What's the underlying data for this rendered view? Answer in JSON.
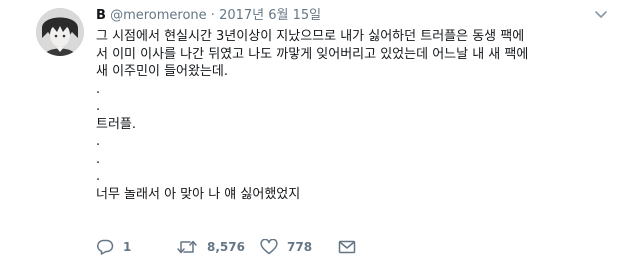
{
  "tweet": {
    "name": "B",
    "handle": "@meromerone",
    "separator": "·",
    "date": "2017년 6월 15일",
    "lines": [
      "그 시점에서 현실시간 3년이상이 지났으므로 내가 싫어하던 트러플은 동생 팩에",
      "서 이미 이사를 나간 뒤였고 나도 까맣게 잊어버리고 있었는데 어느날 내 새 팩에",
      "새 이주민이 들어왔는데.",
      ".",
      ".",
      "트러플.",
      ".",
      ".",
      ".",
      "너무 놀래서 아 맞아 나 얘 싫어했었지"
    ]
  },
  "actions": {
    "reply_icon": "reply-icon",
    "reply_count": "1",
    "retweet_icon": "retweet-icon",
    "retweet_count": "8,576",
    "like_icon": "heart-icon",
    "like_count": "778",
    "dm_icon": "envelope-icon"
  },
  "colors": {
    "text": "#14171a",
    "muted": "#657786"
  }
}
